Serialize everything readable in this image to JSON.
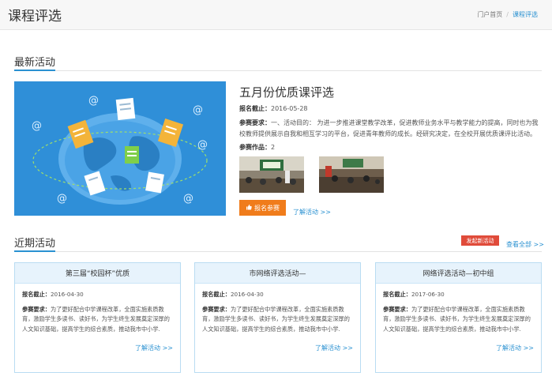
{
  "header": {
    "title": "课程评选",
    "breadcrumb": {
      "home": "门户首页",
      "separator": "/",
      "current": "课程评选"
    }
  },
  "latest": {
    "section_label": "最新活动",
    "title": "五月份优质课评选",
    "deadline_label": "报名截止：",
    "deadline": "2016-05-28",
    "requirement_label": "参赛要求：",
    "requirement": "一、活动目的： 为进一步推进课堂教学改革，促进教师业务水平与教学能力的提高，同时也为我校教师提供展示自我和相互学习的平台，促进青年教师的成长。经研究决定，在全校开展优质课评比活动。",
    "works_label": "参赛作品：",
    "works_count": "2",
    "signup_label": "报名参赛",
    "learn_more": "了解活动 >>"
  },
  "recent": {
    "section_label": "近期活动",
    "launch_label": "发起新活动",
    "view_all": "查看全部 >>",
    "cards": [
      {
        "title": "第三届“校园杯”优质",
        "deadline_label": "报名截止：",
        "deadline": "2016-04-30",
        "requirement_label": "参赛要求：",
        "requirement": "为了更好配合中学课程改革，全面实施素质教育，激励学生多读书、读好书，为学生终生发展奠定深厚的人文知识基础，提高学生的综合素质，推动我市中小学.",
        "learn_more": "了解活动 >>"
      },
      {
        "title": "市网络评选活动—",
        "deadline_label": "报名截止：",
        "deadline": "2016-04-30",
        "requirement_label": "参赛要求：",
        "requirement": "为了更好配合中学课程改革，全面实施素质教育，激励学生多读书、读好书，为学生终生发展奠定深厚的人文知识基础，提高学生的综合素质，推动我市中小学.",
        "learn_more": "了解活动 >>"
      },
      {
        "title": "网络评选活动—初中组",
        "deadline_label": "报名截止：",
        "deadline": "2017-06-30",
        "requirement_label": "参赛要求：",
        "requirement": "为了更好配合中学课程改革，全面实施素质教育，激励学生多读书、读好书，为学生终生发展奠定深厚的人文知识基础，提高学生的综合素质，推动我市中小学.",
        "learn_more": "了解活动 >>"
      }
    ]
  },
  "colors": {
    "accent": "#2a91d1",
    "signup": "#f07c1b",
    "launch": "#e04b3a",
    "banner": "#2f8fd8"
  }
}
